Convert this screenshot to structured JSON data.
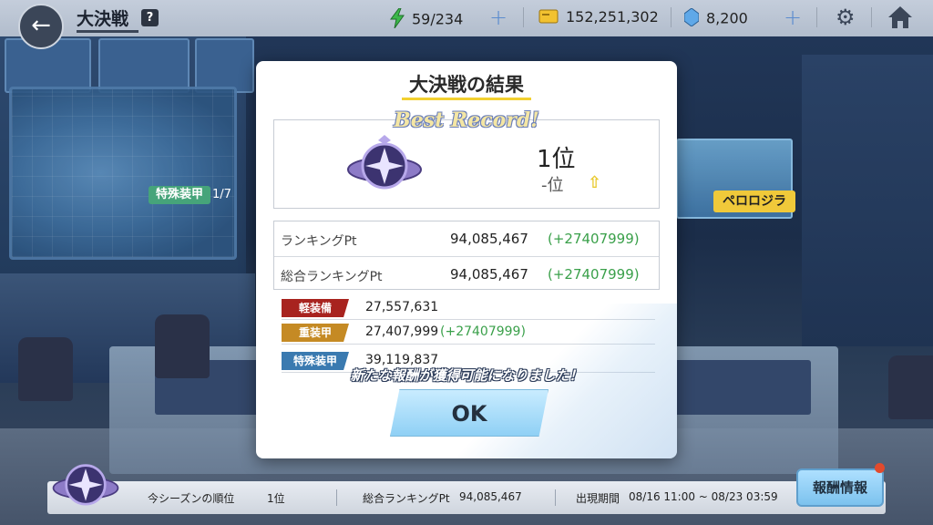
{
  "background": {
    "tag_tokushu": "特殊装甲",
    "tag_count": "1/7",
    "tag_boss": "ペロロジラ"
  },
  "topbar": {
    "title": "大決戦",
    "help_label": "?",
    "stamina": "59/234",
    "credits": "152,251,302",
    "gems": "8,200",
    "plus_label": "+"
  },
  "dialog": {
    "title": "大決戦の結果",
    "best_record": "Best Record!",
    "rank": "1位",
    "prev_rank": "-位",
    "points": [
      {
        "label": "ランキングPt",
        "value": "94,085,467",
        "delta": "(+27407999)"
      },
      {
        "label": "総合ランキングPt",
        "value": "94,085,467",
        "delta": "(+27407999)"
      }
    ],
    "categories": [
      {
        "label": "軽装備",
        "value": "27,557,631",
        "delta": "",
        "color": "#a8231f"
      },
      {
        "label": "重装甲",
        "value": "27,407,999",
        "delta": "(+27407999)",
        "color": "#c58a24"
      },
      {
        "label": "特殊装甲",
        "value": "39,119,837",
        "delta": "",
        "color": "#3a7ab0"
      }
    ],
    "new_reward": "新たな報酬が獲得可能になりました！",
    "ok_label": "OK"
  },
  "bottombar": {
    "season_rank_label": "今シーズンの順位",
    "season_rank": "1位",
    "total_pt_label": "総合ランキングPt",
    "total_pt": "94,085,467",
    "period_label": "出現期間",
    "period": "08/16 11:00 ~ 08/23 03:59",
    "reward_button": "報酬情報"
  },
  "colors": {
    "accent_yellow": "#f2d030",
    "delta_green": "#3aa04a",
    "ok_blue": "#8fd0f5"
  }
}
